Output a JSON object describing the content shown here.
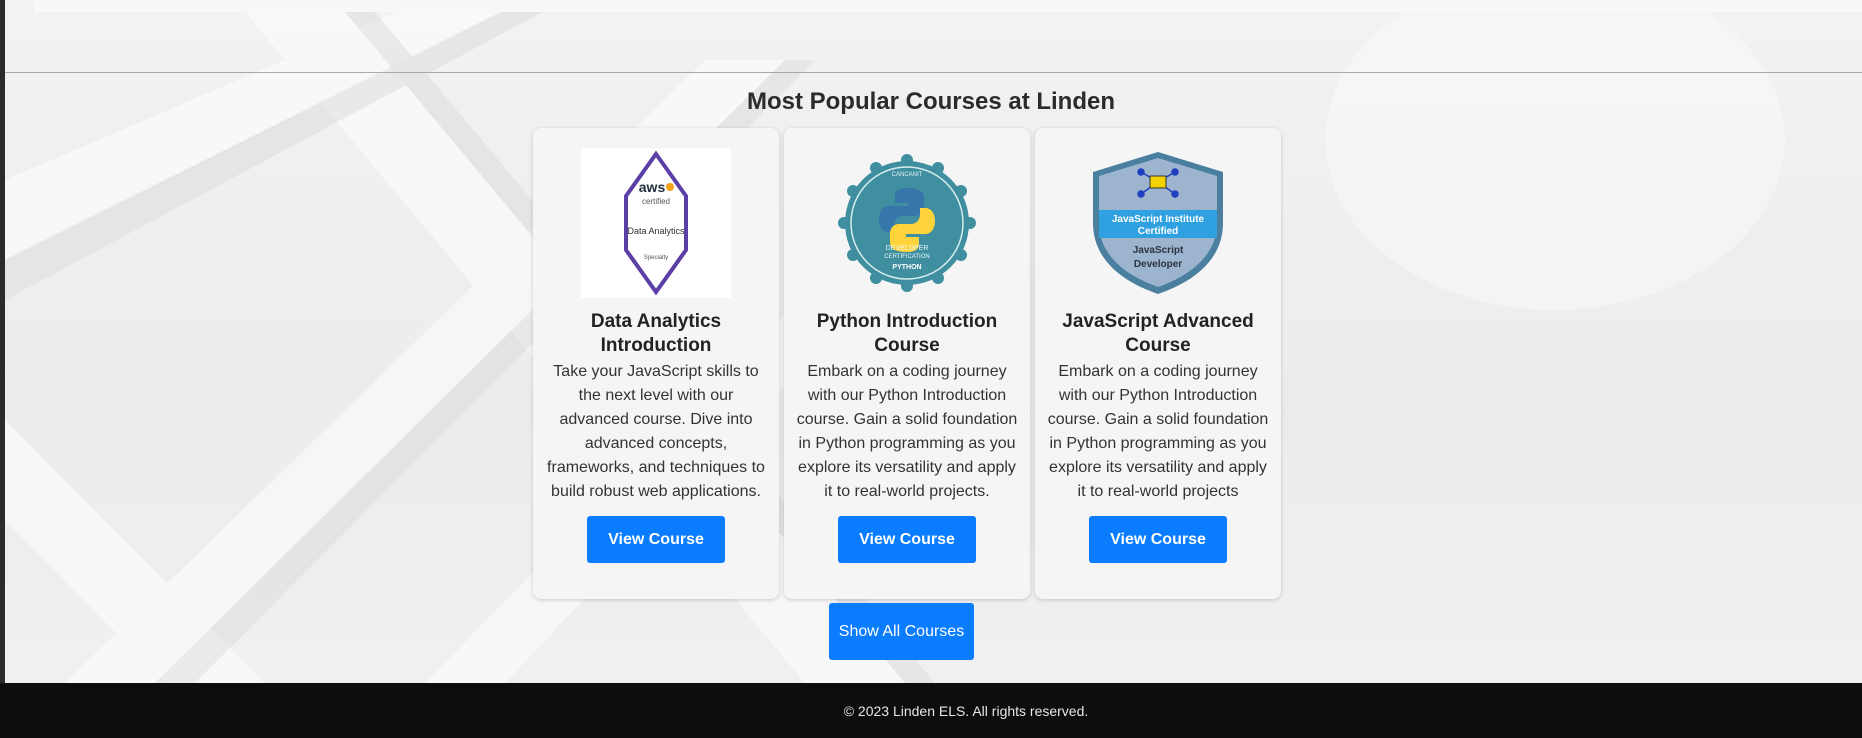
{
  "section": {
    "title": "Most Popular Courses at Linden"
  },
  "courses": [
    {
      "title": "Data Analytics Introduction",
      "description": "Take your JavaScript skills to the next level with our advanced course. Dive into advanced concepts, frameworks, and techniques to build robust web applications.",
      "button": "View Course",
      "badge": {
        "line1": "aws",
        "line2": "certified",
        "line3": "Data Analytics",
        "line4": "Specialty"
      }
    },
    {
      "title": "Python Introduction Course",
      "description": "Embark on a coding journey with our Python Introduction course. Gain a solid foundation in Python programming as you explore its versatility and apply it to real-world projects.",
      "button": "View Course",
      "badge": {
        "top": "CANCANIT",
        "line1": "DEVELOPER",
        "line2": "CERTIFICATION",
        "line3": "PYTHON"
      }
    },
    {
      "title": "JavaScript Advanced Course",
      "description": "Embark on a coding journey with our Python Introduction course. Gain a solid foundation in Python programming as you explore its versatility and apply it to real-world projects",
      "button": "View Course",
      "badge": {
        "line1": "JavaScript Institute",
        "line2": "Certified",
        "line3": "JavaScript",
        "line4": "Developer"
      }
    }
  ],
  "show_all_label": "Show All Courses",
  "footer": {
    "text": "© 2023 Linden ELS. All rights reserved."
  },
  "colors": {
    "primary_button": "#0a7cff",
    "footer_bg": "#0d0d0d"
  }
}
